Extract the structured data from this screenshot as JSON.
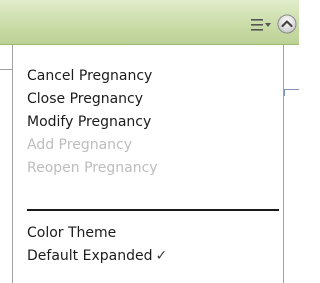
{
  "header": {
    "menu_icon": "hamburger-dropdown-icon",
    "collapse_icon": "chevron-up-circle-icon"
  },
  "menu": {
    "items": [
      {
        "label": "Cancel Pregnancy",
        "enabled": true
      },
      {
        "label": "Close Pregnancy",
        "enabled": true
      },
      {
        "label": "Modify Pregnancy",
        "enabled": true
      },
      {
        "label": "Add Pregnancy",
        "enabled": false
      },
      {
        "label": "Reopen Pregnancy",
        "enabled": false
      }
    ],
    "options": [
      {
        "label": "Color Theme"
      },
      {
        "label": "Default Expanded",
        "checked": true,
        "check_glyph": "✓"
      }
    ]
  },
  "colors": {
    "header_green": "#c9dba6",
    "enabled_text": "#1c1c1c",
    "disabled_text": "#bdbdbd"
  }
}
